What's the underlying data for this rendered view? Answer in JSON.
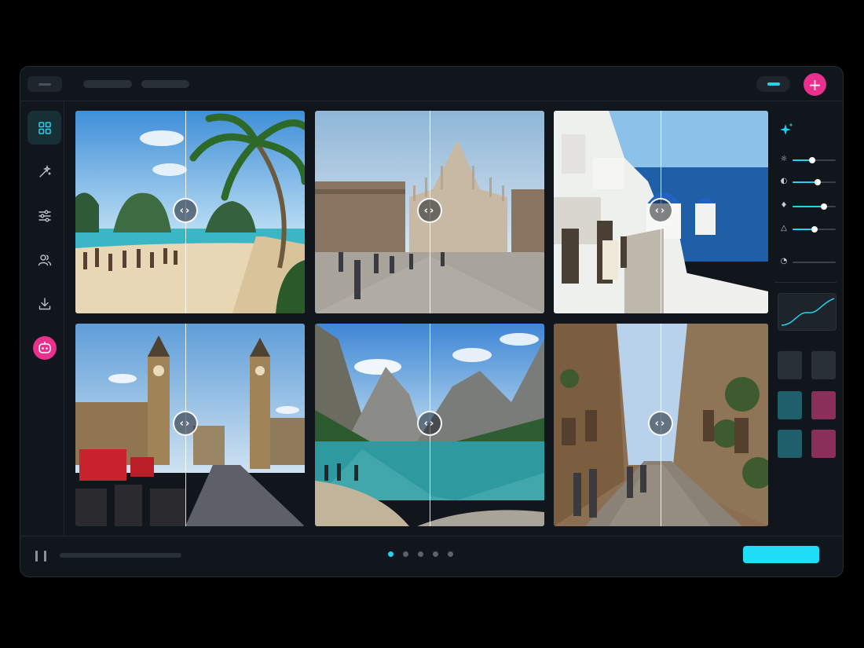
{
  "colors": {
    "accent": "#22d3ee",
    "brand_pink": "#e8308c",
    "window_bg": "#11161c",
    "panel_bg": "#1f252c"
  },
  "topbar": {
    "menu_icon": "menu-icon",
    "toggle_icon": "toggle-icon",
    "add_button_icon": "plus-icon",
    "add_button_glyph": "+"
  },
  "sidebar": {
    "items": [
      {
        "id": "gallery",
        "icon": "grid-icon",
        "active": true
      },
      {
        "id": "magic",
        "icon": "magic-wand-icon",
        "active": false
      },
      {
        "id": "adjust",
        "icon": "sliders-icon",
        "active": false
      },
      {
        "id": "people",
        "icon": "users-icon",
        "active": false
      },
      {
        "id": "export",
        "icon": "download-icon",
        "active": false
      },
      {
        "id": "assistant",
        "icon": "robot-icon",
        "active": false
      }
    ]
  },
  "gallery": {
    "tiles": [
      {
        "scene": "tropical beach with palm tree",
        "split": 0.48,
        "handle_glyph": "‹›"
      },
      {
        "scene": "cathedral square",
        "split": 0.5,
        "handle_glyph": "‹›"
      },
      {
        "scene": "white houses above blue sea",
        "split": 0.5,
        "handle_glyph": "‹›"
      },
      {
        "scene": "clock tower and red buses",
        "split": 0.48,
        "handle_glyph": "‹›"
      },
      {
        "scene": "mountain lake",
        "split": 0.5,
        "handle_glyph": "‹›"
      },
      {
        "scene": "old town stone street",
        "split": 0.5,
        "handle_glyph": "‹›"
      }
    ]
  },
  "adjustments": {
    "sparkle_icon": "sparkle-icon",
    "sliders": [
      {
        "icon": "sun-icon",
        "glyph": "☼",
        "value": 0.45
      },
      {
        "icon": "contrast-icon",
        "glyph": "◐",
        "value": 0.58
      },
      {
        "icon": "drop-icon",
        "glyph": "♦",
        "value": 0.72
      },
      {
        "icon": "warning-icon",
        "glyph": "△",
        "value": 0.5
      },
      {
        "icon": "timer-icon",
        "glyph": "◔",
        "value": 0.0
      }
    ],
    "swatches": [
      "#2a3038",
      "#2a3038",
      "#1f5f6b",
      "#8a2f5a",
      "#1f5f6b",
      "#8a2f5a"
    ]
  },
  "bottombar": {
    "pause_icon": "pause-icon",
    "progress": 0.0,
    "pages": 5,
    "active_page": 1
  }
}
